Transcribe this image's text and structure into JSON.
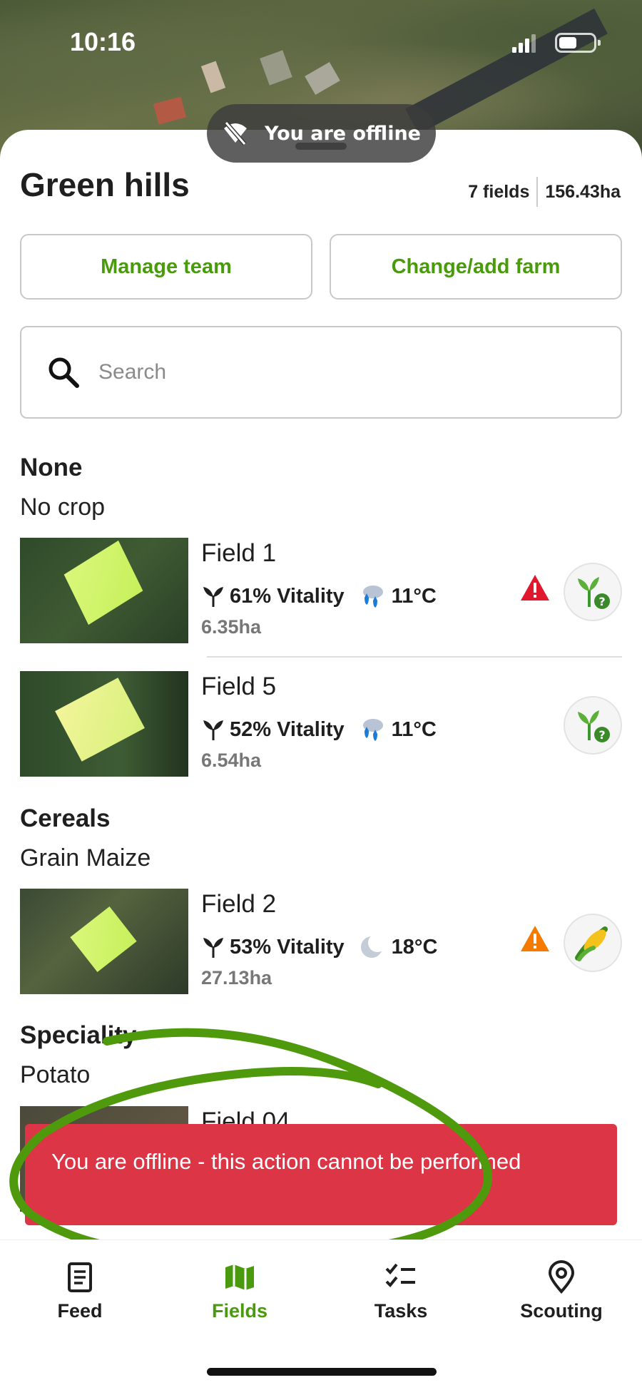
{
  "status_bar": {
    "time": "10:16"
  },
  "offline_banner": {
    "text": "You are offline",
    "icon": "wifi-off-icon"
  },
  "farm": {
    "name": "Green hills",
    "fields_count": "7 fields",
    "total_area": "156.43ha",
    "manage_team_label": "Manage team",
    "change_farm_label": "Change/add farm"
  },
  "search": {
    "placeholder": "Search",
    "value": ""
  },
  "groups": [
    {
      "title": "None",
      "subtitle": "No crop",
      "fields": [
        {
          "name": "Field 1",
          "vitality": "61% Vitality",
          "temp": "11°C",
          "weather_icon": "rain-icon",
          "area": "6.35ha",
          "alert": "red",
          "crop_icon": "unknown-crop-icon"
        },
        {
          "name": "Field 5",
          "vitality": "52% Vitality",
          "temp": "11°C",
          "weather_icon": "rain-icon",
          "area": "6.54ha",
          "alert": "",
          "crop_icon": "unknown-crop-icon"
        }
      ]
    },
    {
      "title": "Cereals",
      "subtitle": "Grain Maize",
      "fields": [
        {
          "name": "Field 2",
          "vitality": "53% Vitality",
          "temp": "18°C",
          "weather_icon": "moon-icon",
          "area": "27.13ha",
          "alert": "orange",
          "crop_icon": "corn-icon"
        }
      ]
    },
    {
      "title": "Speciality",
      "subtitle": "Potato",
      "fields": [
        {
          "name": "Field 04",
          "vitality": "",
          "temp": "",
          "weather_icon": "",
          "area": "",
          "alert": "",
          "crop_icon": ""
        }
      ]
    }
  ],
  "toast": {
    "message": "You are offline - this action cannot be performed"
  },
  "tabs": [
    {
      "label": "Feed",
      "icon": "document-icon",
      "active": false
    },
    {
      "label": "Fields",
      "icon": "map-icon",
      "active": true
    },
    {
      "label": "Tasks",
      "icon": "checklist-icon",
      "active": false
    },
    {
      "label": "Scouting",
      "icon": "location-pin-icon",
      "active": false
    }
  ],
  "colors": {
    "accent": "#4a9a0e",
    "toast_bg": "#dc3545",
    "alert_red": "#e0182d",
    "alert_orange": "#f57b00",
    "annotation": "#4e9a0c"
  }
}
